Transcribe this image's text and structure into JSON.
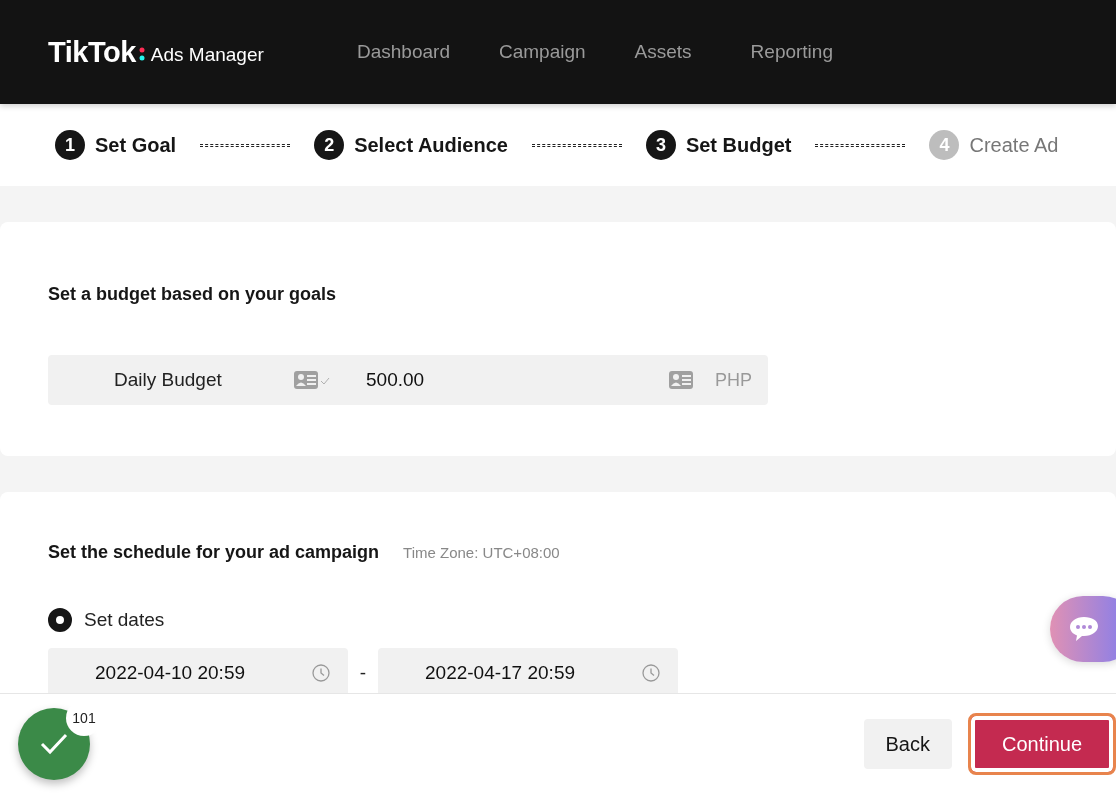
{
  "header": {
    "logo": "TikTok",
    "product": "Ads Manager",
    "nav": [
      {
        "label": "Dashboard"
      },
      {
        "label": "Campaign"
      },
      {
        "label": "Assets"
      },
      {
        "label": "Reporting"
      }
    ]
  },
  "steps": [
    {
      "number": "1",
      "label": "Set Goal",
      "disabled": false
    },
    {
      "number": "2",
      "label": "Select Audience",
      "disabled": false
    },
    {
      "number": "3",
      "label": "Set Budget",
      "disabled": false
    },
    {
      "number": "4",
      "label": "Create Ad",
      "disabled": true
    }
  ],
  "budget": {
    "title": "Set a budget based on your goals",
    "type": "Daily Budget",
    "amount": "500.00",
    "currency": "PHP"
  },
  "schedule": {
    "title": "Set the schedule for your ad campaign",
    "timezone": "Time Zone: UTC+08:00",
    "option": {
      "label": "Set dates",
      "selected": true
    },
    "start": "2022-04-10 20:59",
    "separator": "-",
    "end": "2022-04-17 20:59"
  },
  "footer": {
    "buttons": [
      {
        "label": "Back",
        "kind": "secondary",
        "focused": false
      },
      {
        "label": "Continue",
        "kind": "primary",
        "focused": true
      }
    ]
  },
  "task_badge": {
    "count": "101"
  }
}
